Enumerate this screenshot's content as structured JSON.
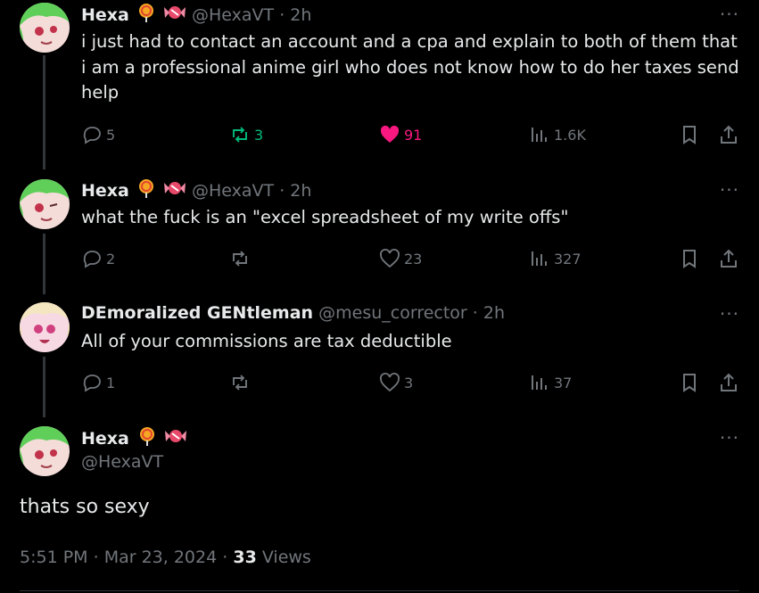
{
  "replies": [
    {
      "name": "Hexa",
      "handle": "@HexaVT",
      "time": "2h",
      "text": "i just had to contact an account and a cpa and explain to both of them that i am a professional anime girl who does not know how to do her taxes send help",
      "replies": "5",
      "reposts": "3",
      "likes": "91",
      "views": "1.6K"
    },
    {
      "name": "Hexa",
      "handle": "@HexaVT",
      "time": "2h",
      "text": "what the fuck is an \"excel spreadsheet of my write offs\"",
      "replies": "2",
      "reposts": "",
      "likes": "23",
      "views": "327"
    },
    {
      "name": "DEmoralized GENtleman",
      "handle": "@mesu_corrector",
      "time": "2h",
      "text": "All of your commissions are tax deductible",
      "replies": "1",
      "reposts": "",
      "likes": "3",
      "views": "37"
    }
  ],
  "main": {
    "name": "Hexa",
    "handle": "@HexaVT",
    "text": "thats so sexy",
    "time": "5:51 PM",
    "date": "Mar 23, 2024",
    "views_count": "33",
    "views_label": "Views"
  },
  "colors": {
    "accent_green": "#00ba7c",
    "accent_pink": "#f91880",
    "muted": "#71767b"
  },
  "icons": [
    "reply-icon",
    "repost-icon",
    "like-icon",
    "views-icon",
    "bookmark-icon",
    "share-icon",
    "more-icon",
    "lollipop-emoji",
    "candy-emoji"
  ]
}
